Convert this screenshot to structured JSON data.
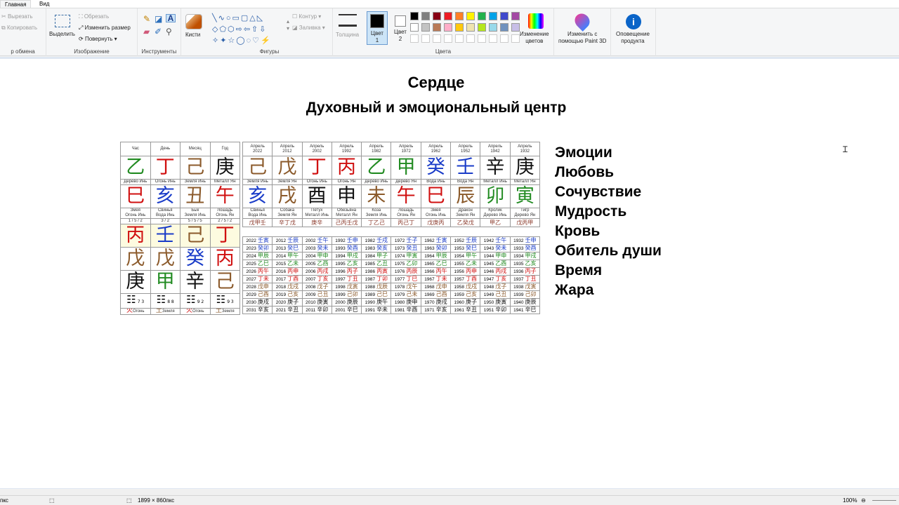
{
  "tabs": {
    "home": "Главная",
    "view": "Вид"
  },
  "ribbon": {
    "cut": "Вырезать",
    "copy": "Копировать",
    "clipboard_group": "р обмена",
    "select": "Выделить",
    "crop": "Обрезать",
    "resize": "Изменить размер",
    "rotate": "Повернуть",
    "image_group": "Изображение",
    "tools_group": "Инструменты",
    "brushes": "Кисти",
    "shapes_group": "Фигуры",
    "outline": "Контур",
    "fill": "Заливка",
    "size": "Толщина",
    "color1_line1": "Цвет",
    "color1_line2": "1",
    "color2_line1": "Цвет",
    "color2_line2": "2",
    "edit_colors_l1": "Изменение",
    "edit_colors_l2": "цветов",
    "colors_group": "Цвета",
    "paint3d_l1": "Изменить с",
    "paint3d_l2": "помощью Paint 3D",
    "notify_l1": "Оповещение",
    "notify_l2": "продукта",
    "palette": [
      "#000000",
      "#7f7f7f",
      "#880015",
      "#ed1c24",
      "#ff7f27",
      "#fff200",
      "#22b14c",
      "#00a2e8",
      "#3f48cc",
      "#a349a4",
      "#ffffff",
      "#c3c3c3",
      "#b97a57",
      "#ffaec9",
      "#ffc90e",
      "#efe4b0",
      "#b5e61d",
      "#99d9ea",
      "#7092be",
      "#c8bfe7"
    ]
  },
  "page": {
    "title": "Сердце",
    "subtitle": "Духовный и эмоциональный центр",
    "keywords": [
      "Эмоции",
      "Любовь",
      "Сочувствие",
      "Мудрость",
      "Кровь",
      "Обитель души",
      "Время",
      "Жара"
    ]
  },
  "chartA": {
    "headers": [
      "Час",
      "День",
      "Месяц",
      "Год"
    ],
    "stems": [
      {
        "g": "乙",
        "c": "#228b22"
      },
      {
        "g": "丁",
        "c": "#d01010"
      },
      {
        "g": "己",
        "c": "#8b5a2b"
      },
      {
        "g": "庚",
        "c": "#111111"
      }
    ],
    "stem_labels": [
      "Дерево Инь",
      "Огонь Инь",
      "Земля Инь",
      "Металл Ян"
    ],
    "branches": [
      {
        "g": "巳",
        "c": "#d01010"
      },
      {
        "g": "亥",
        "c": "#1a3cc8"
      },
      {
        "g": "丑",
        "c": "#8b5a2b"
      },
      {
        "g": "午",
        "c": "#d01010"
      }
    ],
    "branch_l1": [
      "Змея",
      "Свинья",
      "Бык",
      "Лошадь"
    ],
    "branch_l2": [
      "Огонь Инь",
      "Вода Инь",
      "Земля Инь",
      "Огонь Ян"
    ],
    "ratios": [
      "1 / 5 / 2",
      "3 / 2",
      "5 / 5 / 5",
      "2 / 5 / 2"
    ],
    "hidden": [
      [
        {
          "g": "丙",
          "c": "#d01010"
        },
        {
          "g": "壬",
          "c": "#1a3cc8"
        },
        {
          "g": "己",
          "c": "#8b5a2b"
        },
        {
          "g": "丁",
          "c": "#d01010"
        }
      ],
      [
        {
          "g": "戊",
          "c": "#8b5a2b"
        },
        {
          "g": "戊",
          "c": "#8b5a2b"
        },
        {
          "g": "癸",
          "c": "#1a3cc8"
        },
        {
          "g": "丙",
          "c": "#d01010"
        }
      ],
      [
        {
          "g": "庚",
          "c": "#111111"
        },
        {
          "g": "甲",
          "c": "#228b22"
        },
        {
          "g": "辛",
          "c": "#111111"
        },
        {
          "g": "己",
          "c": "#8b5a2b"
        }
      ]
    ],
    "trigrams": [
      "☷",
      "☷",
      "☷",
      "☷"
    ],
    "trigram_nums": [
      "7 3",
      "8 8",
      "9 2",
      "9 3"
    ],
    "elements": [
      {
        "g": "火",
        "t": "Огонь",
        "c": "#d01010"
      },
      {
        "g": "土",
        "t": "Земля",
        "c": "#8b5a2b"
      },
      {
        "g": "火",
        "t": "Огонь",
        "c": "#d01010"
      },
      {
        "g": "土",
        "t": "Земля",
        "c": "#8b5a2b"
      }
    ]
  },
  "chartB": {
    "header_month": "Апрель",
    "years": [
      "2022",
      "2012",
      "2002",
      "1992",
      "1982",
      "1972",
      "1962",
      "1952",
      "1942",
      "1932"
    ],
    "stems": [
      {
        "g": "己",
        "c": "#8b5a2b"
      },
      {
        "g": "戊",
        "c": "#8b5a2b"
      },
      {
        "g": "丁",
        "c": "#d01010"
      },
      {
        "g": "丙",
        "c": "#d01010"
      },
      {
        "g": "乙",
        "c": "#228b22"
      },
      {
        "g": "甲",
        "c": "#228b22"
      },
      {
        "g": "癸",
        "c": "#1a3cc8"
      },
      {
        "g": "壬",
        "c": "#1a3cc8"
      },
      {
        "g": "辛",
        "c": "#111111"
      },
      {
        "g": "庚",
        "c": "#111111"
      }
    ],
    "stem_labels": [
      "Земля Инь",
      "Земля Ян",
      "Огонь Инь",
      "Огонь Ян",
      "Дерево Инь",
      "Дерево Ян",
      "Вода Инь",
      "Вода Ян",
      "Металл Инь",
      "Металл Ян"
    ],
    "branches": [
      {
        "g": "亥",
        "c": "#1a3cc8"
      },
      {
        "g": "戌",
        "c": "#8b5a2b"
      },
      {
        "g": "酉",
        "c": "#111111"
      },
      {
        "g": "申",
        "c": "#111111"
      },
      {
        "g": "未",
        "c": "#8b5a2b"
      },
      {
        "g": "午",
        "c": "#d01010"
      },
      {
        "g": "巳",
        "c": "#d01010"
      },
      {
        "g": "辰",
        "c": "#8b5a2b"
      },
      {
        "g": "卯",
        "c": "#228b22"
      },
      {
        "g": "寅",
        "c": "#228b22"
      }
    ],
    "branch_l1": [
      "Свинья",
      "Собака",
      "Петух",
      "Обезьяна",
      "Коза",
      "Лошадь",
      "Змея",
      "Дракон",
      "Кролик",
      "Тигр"
    ],
    "branch_l2": [
      "Вода Инь",
      "Земля Ян",
      "Металл Инь",
      "Металл Ян",
      "Земля Инь",
      "Огонь Ян",
      "Огонь Инь",
      "Земля Ян",
      "Дерево Инь",
      "Дерево Ян"
    ],
    "hidden": [
      "戊甲壬",
      "辛丁戊",
      "庚辛",
      "己丙壬戊",
      "丁乙己",
      "丙己丁",
      "戊庚丙",
      "乙癸戊",
      "甲乙",
      "戊丙甲"
    ]
  },
  "chartC": {
    "rows": [
      [
        [
          "2022",
          "壬寅"
        ],
        [
          "2012",
          "壬辰"
        ],
        [
          "2002",
          "壬午"
        ],
        [
          "1992",
          "壬申"
        ],
        [
          "1982",
          "壬戌"
        ],
        [
          "1972",
          "壬子"
        ],
        [
          "1962",
          "壬寅"
        ],
        [
          "1952",
          "壬辰"
        ],
        [
          "1942",
          "壬午"
        ],
        [
          "1932",
          "壬申"
        ]
      ],
      [
        [
          "2023",
          "癸卯"
        ],
        [
          "2013",
          "癸巳"
        ],
        [
          "2003",
          "癸未"
        ],
        [
          "1993",
          "癸酉"
        ],
        [
          "1983",
          "癸亥"
        ],
        [
          "1973",
          "癸丑"
        ],
        [
          "1963",
          "癸卯"
        ],
        [
          "1953",
          "癸巳"
        ],
        [
          "1943",
          "癸未"
        ],
        [
          "1933",
          "癸酉"
        ]
      ],
      [
        [
          "2024",
          "甲辰"
        ],
        [
          "2014",
          "甲午"
        ],
        [
          "2004",
          "甲申"
        ],
        [
          "1994",
          "甲戌"
        ],
        [
          "1984",
          "甲子"
        ],
        [
          "1974",
          "甲寅"
        ],
        [
          "1964",
          "甲辰"
        ],
        [
          "1954",
          "甲午"
        ],
        [
          "1944",
          "甲申"
        ],
        [
          "1934",
          "甲戌"
        ]
      ],
      [
        [
          "2025",
          "乙巳"
        ],
        [
          "2015",
          "乙未"
        ],
        [
          "2005",
          "乙酉"
        ],
        [
          "1995",
          "乙亥"
        ],
        [
          "1985",
          "乙丑"
        ],
        [
          "1975",
          "乙卯"
        ],
        [
          "1965",
          "乙巳"
        ],
        [
          "1955",
          "乙未"
        ],
        [
          "1945",
          "乙酉"
        ],
        [
          "1935",
          "乙亥"
        ]
      ],
      [
        [
          "2026",
          "丙午"
        ],
        [
          "2016",
          "丙申"
        ],
        [
          "2006",
          "丙戌"
        ],
        [
          "1996",
          "丙子"
        ],
        [
          "1986",
          "丙寅"
        ],
        [
          "1976",
          "丙辰"
        ],
        [
          "1966",
          "丙午"
        ],
        [
          "1956",
          "丙申"
        ],
        [
          "1946",
          "丙戌"
        ],
        [
          "1936",
          "丙子"
        ]
      ],
      [
        [
          "2027",
          "丁未"
        ],
        [
          "2017",
          "丁酉"
        ],
        [
          "2007",
          "丁亥"
        ],
        [
          "1997",
          "丁丑"
        ],
        [
          "1987",
          "丁卯"
        ],
        [
          "1977",
          "丁巳"
        ],
        [
          "1967",
          "丁未"
        ],
        [
          "1957",
          "丁酉"
        ],
        [
          "1947",
          "丁亥"
        ],
        [
          "1937",
          "丁丑"
        ]
      ],
      [
        [
          "2028",
          "戊申"
        ],
        [
          "2018",
          "戊戌"
        ],
        [
          "2008",
          "戊子"
        ],
        [
          "1998",
          "戊寅"
        ],
        [
          "1988",
          "戊辰"
        ],
        [
          "1978",
          "戊午"
        ],
        [
          "1968",
          "戊申"
        ],
        [
          "1958",
          "戊戌"
        ],
        [
          "1948",
          "戊子"
        ],
        [
          "1938",
          "戊寅"
        ]
      ],
      [
        [
          "2029",
          "己酉"
        ],
        [
          "2019",
          "己亥"
        ],
        [
          "2009",
          "己丑"
        ],
        [
          "1999",
          "己卯"
        ],
        [
          "1989",
          "己巳"
        ],
        [
          "1979",
          "己未"
        ],
        [
          "1969",
          "己酉"
        ],
        [
          "1959",
          "己亥"
        ],
        [
          "1949",
          "己丑"
        ],
        [
          "1939",
          "己卯"
        ]
      ],
      [
        [
          "2030",
          "庚戌"
        ],
        [
          "2020",
          "庚子"
        ],
        [
          "2010",
          "庚寅"
        ],
        [
          "2000",
          "庚辰"
        ],
        [
          "1990",
          "庚午"
        ],
        [
          "1980",
          "庚申"
        ],
        [
          "1970",
          "庚戌"
        ],
        [
          "1960",
          "庚子"
        ],
        [
          "1950",
          "庚寅"
        ],
        [
          "1940",
          "庚辰"
        ]
      ],
      [
        [
          "2031",
          "辛亥"
        ],
        [
          "2021",
          "辛丑"
        ],
        [
          "2011",
          "辛卯"
        ],
        [
          "2001",
          "辛巳"
        ],
        [
          "1991",
          "辛未"
        ],
        [
          "1981",
          "辛酉"
        ],
        [
          "1971",
          "辛亥"
        ],
        [
          "1961",
          "辛丑"
        ],
        [
          "1951",
          "辛卯"
        ],
        [
          "1941",
          "辛巳"
        ]
      ]
    ]
  },
  "status": {
    "pos_unit": "пкс",
    "dims": "1899 × 860пкс",
    "zoom": "100%"
  }
}
